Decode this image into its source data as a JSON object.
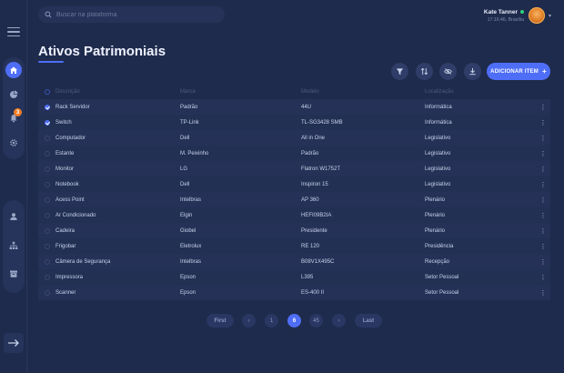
{
  "search": {
    "placeholder": "Buscar na plataforma"
  },
  "user": {
    "name": "Kate Tanner",
    "subtitle": "17:16:46, Brasília",
    "status_color": "#2fd47b"
  },
  "rail": {
    "items": [
      {
        "icon": "home-icon",
        "active": true
      },
      {
        "icon": "pie-chart-icon",
        "active": false
      },
      {
        "icon": "bell-icon",
        "active": false,
        "badge": "3"
      },
      {
        "icon": "gear-icon",
        "active": false
      },
      {
        "icon": "user-icon",
        "active": false
      },
      {
        "icon": "org-chart-icon",
        "active": false
      },
      {
        "icon": "archive-icon",
        "active": false
      },
      {
        "icon": "logout-arrow-icon",
        "active": false
      }
    ]
  },
  "page": {
    "title": "Ativos Patrimoniais"
  },
  "toolbar": {
    "buttons": [
      "filter-icon",
      "sort-icon",
      "visibility-icon",
      "download-icon"
    ],
    "add_label": "ADICIONAR ITEM",
    "add_icon": "+"
  },
  "table": {
    "headers": {
      "descricao": "Descrição",
      "marca": "Marca",
      "modelo": "Modelo",
      "localizacao": "Localização"
    },
    "rows": [
      {
        "checked": true,
        "descricao": "Rack Servidor",
        "marca": "Padrão",
        "modelo": "44U",
        "localizacao": "Informática",
        "menu": "⋮"
      },
      {
        "checked": true,
        "descricao": "Switch",
        "marca": "TP-Link",
        "modelo": "TL-SG3428 SMB",
        "localizacao": "Informática",
        "menu": "⋮"
      },
      {
        "checked": false,
        "descricao": "Computador",
        "marca": "Dell",
        "modelo": "All in One",
        "localizacao": "Legislativo",
        "menu": "⋮"
      },
      {
        "checked": false,
        "descricao": "Estante",
        "marca": "M. Peixinho",
        "modelo": "Padrão",
        "localizacao": "Legislativo",
        "menu": "⋮"
      },
      {
        "checked": false,
        "descricao": "Monitor",
        "marca": "LG",
        "modelo": "Flatron W1752T",
        "localizacao": "Legislativo",
        "menu": "⋮"
      },
      {
        "checked": false,
        "descricao": "Notebook",
        "marca": "Dell",
        "modelo": "Inspiron 15",
        "localizacao": "Legislativo",
        "menu": "⋮"
      },
      {
        "checked": false,
        "descricao": "Acess Point",
        "marca": "Intelbras",
        "modelo": "AP 360",
        "localizacao": "Plenário",
        "menu": "⋮"
      },
      {
        "checked": false,
        "descricao": "Ar Condicionado",
        "marca": "Elgin",
        "modelo": "HEFI09B2IA",
        "localizacao": "Plenário",
        "menu": "⋮"
      },
      {
        "checked": false,
        "descricao": "Cadeira",
        "marca": "Giobel",
        "modelo": "Presidente",
        "localizacao": "Plenário",
        "menu": "⋮"
      },
      {
        "checked": false,
        "descricao": "Frigobar",
        "marca": "Eletrolux",
        "modelo": "RE 120",
        "localizacao": "Presidência",
        "menu": "⋮"
      },
      {
        "checked": false,
        "descricao": "Câmera de Segurança",
        "marca": "Intelbras",
        "modelo": "B08V1X495C",
        "localizacao": "Recepção",
        "menu": "⋮"
      },
      {
        "checked": false,
        "descricao": "Impressora",
        "marca": "Epson",
        "modelo": "L395",
        "localizacao": "Setor Pessoal",
        "menu": "⋮"
      },
      {
        "checked": false,
        "descricao": "Scanner",
        "marca": "Epson",
        "modelo": "ES-400 II",
        "localizacao": "Setor Pessoal",
        "menu": "⋮"
      }
    ]
  },
  "pagination": {
    "first": "First",
    "last": "Last",
    "prev": "‹",
    "next": "›",
    "pages": [
      "1",
      "6",
      "45"
    ],
    "current": "6"
  },
  "colors": {
    "accent": "#4f6ef7",
    "background": "#1f2b4c",
    "badge": "#f07e27"
  }
}
